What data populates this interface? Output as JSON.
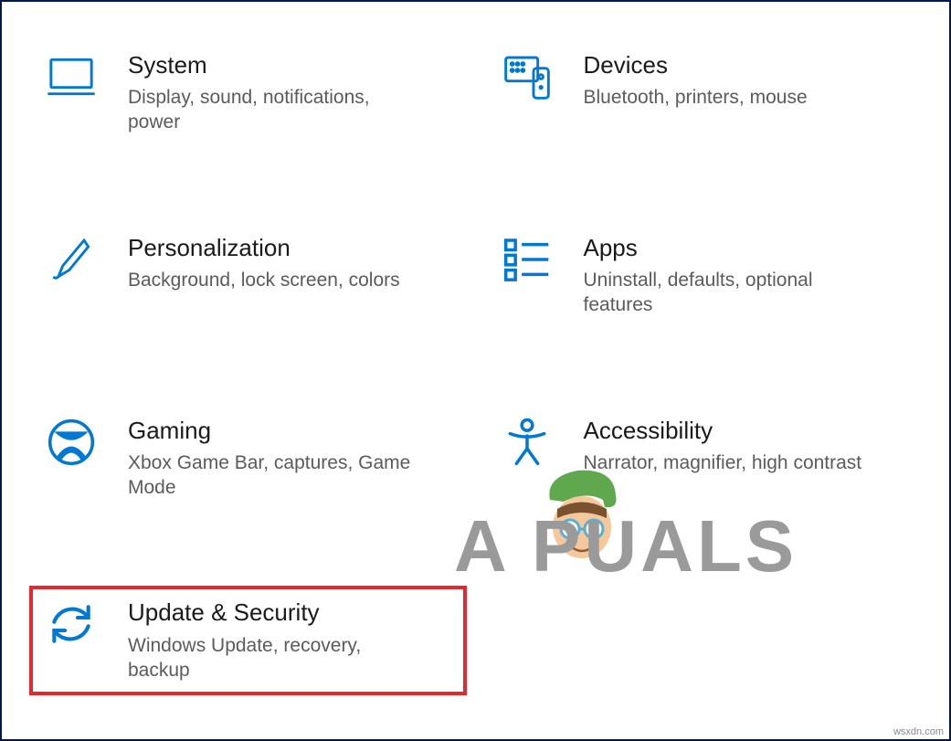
{
  "tiles": [
    {
      "id": "system",
      "title": "System",
      "desc": "Display, sound, notifications, power",
      "highlighted": false
    },
    {
      "id": "devices",
      "title": "Devices",
      "desc": "Bluetooth, printers, mouse",
      "highlighted": false
    },
    {
      "id": "personalization",
      "title": "Personalization",
      "desc": "Background, lock screen, colors",
      "highlighted": false
    },
    {
      "id": "apps",
      "title": "Apps",
      "desc": "Uninstall, defaults, optional features",
      "highlighted": false
    },
    {
      "id": "gaming",
      "title": "Gaming",
      "desc": "Xbox Game Bar, captures, Game Mode",
      "highlighted": false
    },
    {
      "id": "accessibility",
      "title": "Accessibility",
      "desc": "Narrator, magnifier, high contrast",
      "highlighted": false
    },
    {
      "id": "update-security",
      "title": "Update & Security",
      "desc": "Windows Update, recovery, backup",
      "highlighted": true
    }
  ],
  "watermark": "A   PUALS",
  "attribution": "wsxdn.com",
  "colors": {
    "accent": "#0078d4",
    "highlight": "#e3292f"
  }
}
